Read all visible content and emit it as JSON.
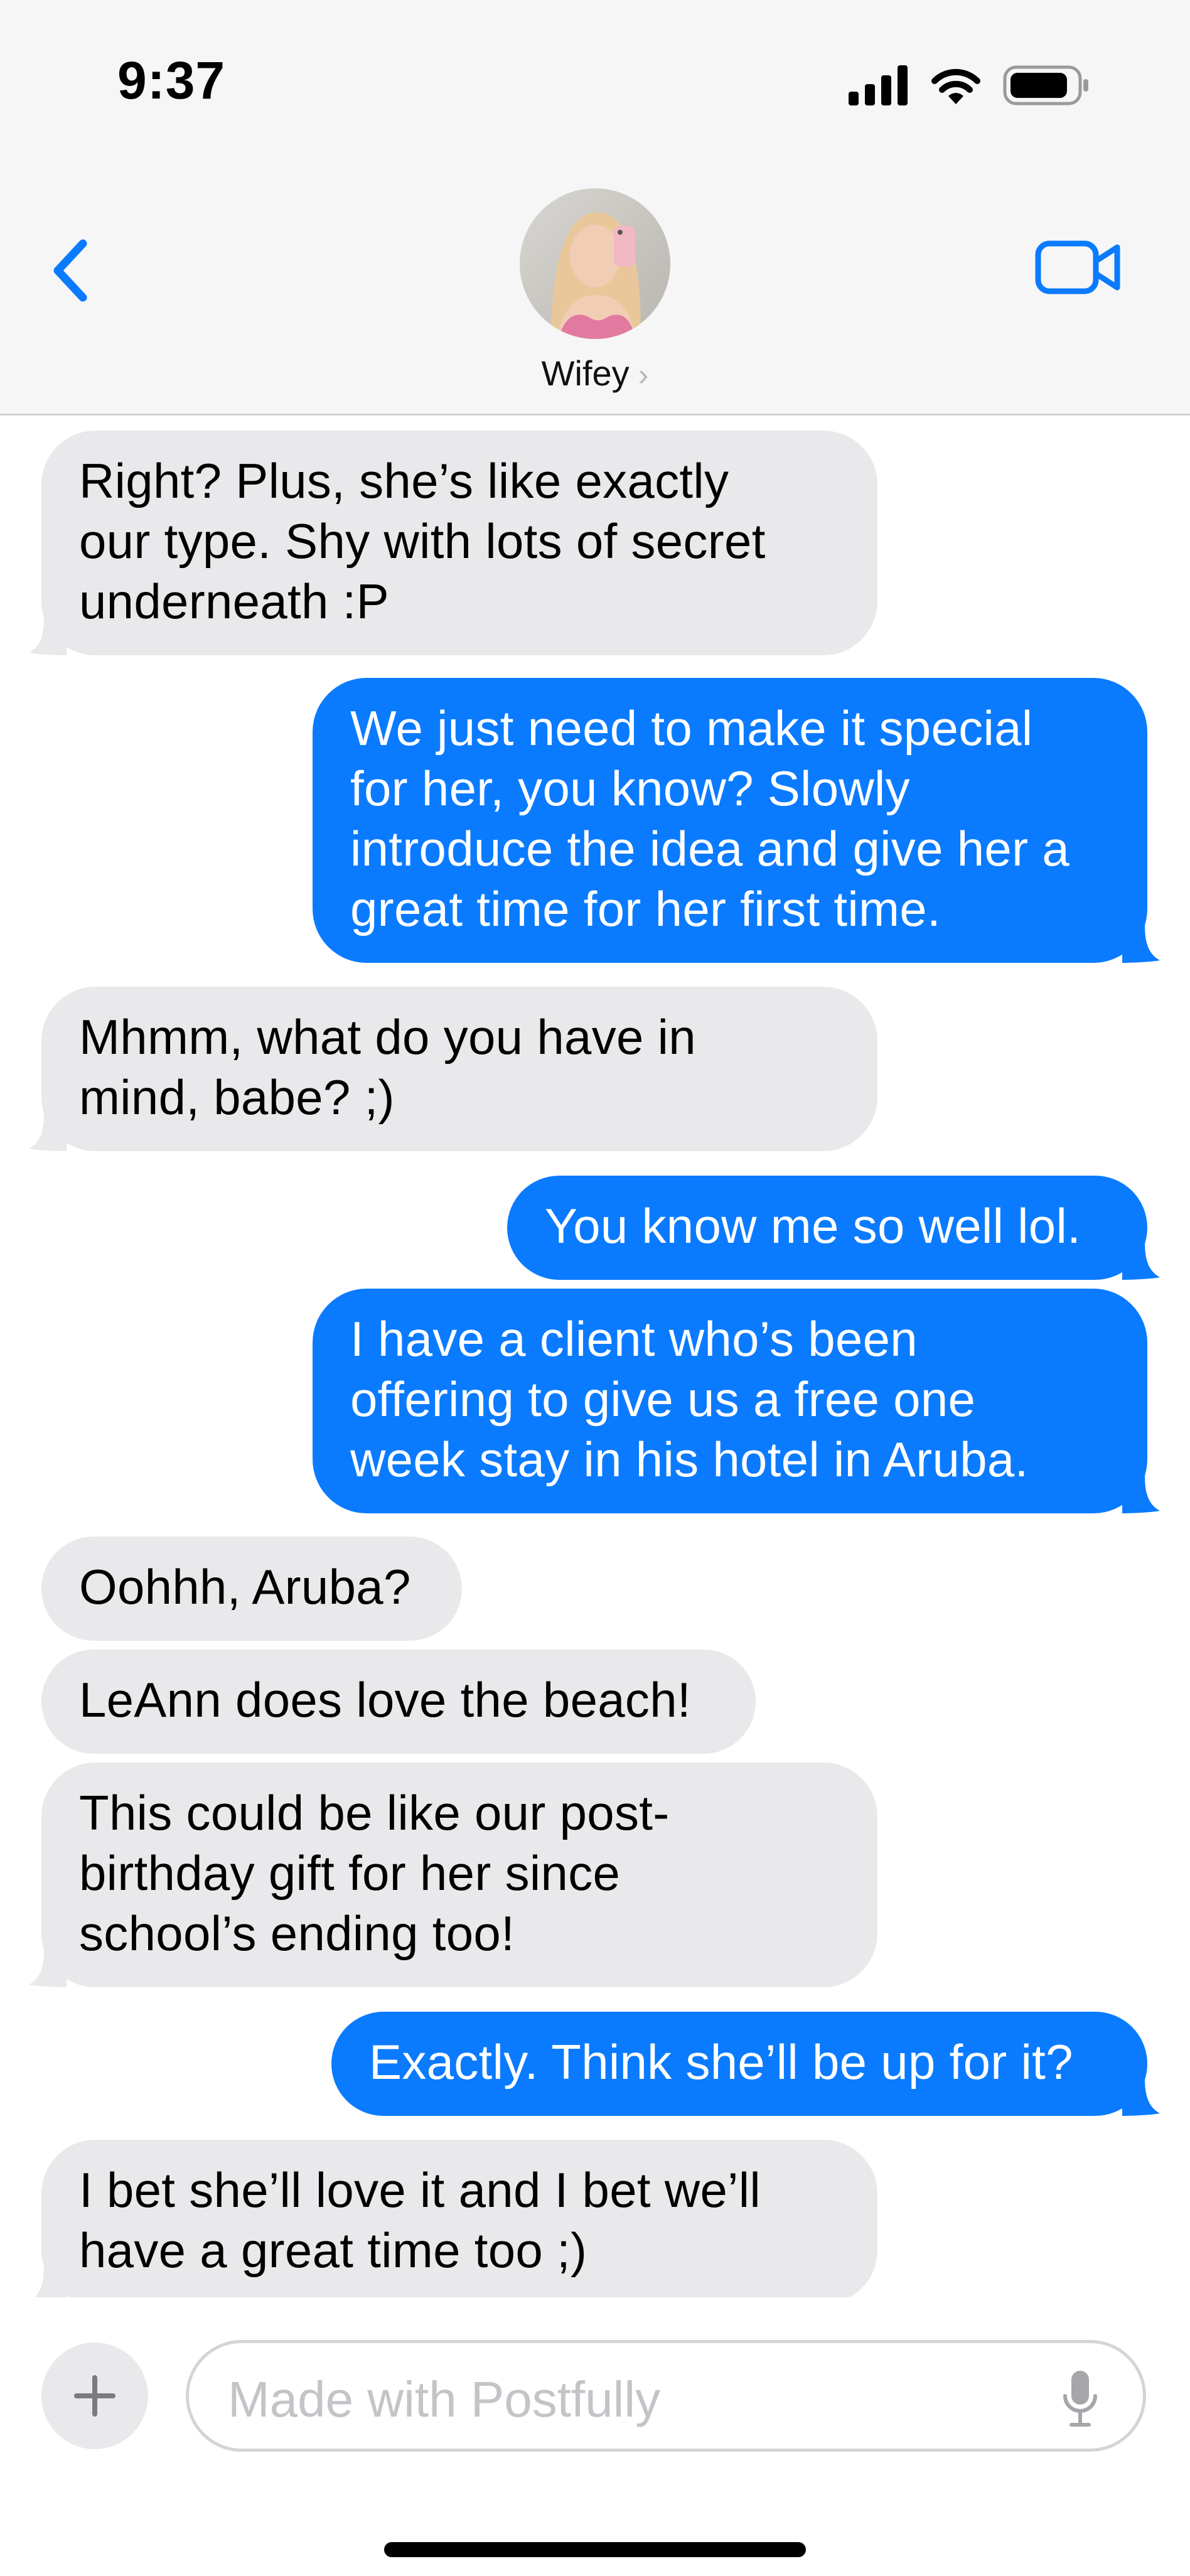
{
  "status_bar": {
    "time": "9:37"
  },
  "header": {
    "contact_name": "Wifey",
    "name_chevron": "›"
  },
  "messages": [
    {
      "from": "them",
      "lines": [
        "Right? Plus, she’s like exactly",
        "our type. Shy with lots of secret",
        "underneath :P"
      ]
    },
    {
      "from": "me",
      "lines": [
        "We just need to make it special",
        "for her, you know? Slowly",
        "introduce the idea and give her a",
        "great time for her first time."
      ]
    },
    {
      "from": "them",
      "lines": [
        "Mhmm, what do you have in",
        "mind, babe? ;)"
      ]
    },
    {
      "from": "me",
      "lines": [
        "You know me so well lol."
      ]
    },
    {
      "from": "me",
      "lines": [
        "I have a client who’s been",
        "offering to give us a free one",
        "week stay in his hotel in Aruba."
      ]
    },
    {
      "from": "them",
      "lines": [
        "Oohhh, Aruba?"
      ]
    },
    {
      "from": "them",
      "lines": [
        "LeAnn does love the beach!"
      ]
    },
    {
      "from": "them",
      "lines": [
        "This could be like our post-",
        "birthday gift for her since",
        "school’s ending too!"
      ]
    },
    {
      "from": "me",
      "lines": [
        "Exactly. Think she’ll be up for it?"
      ]
    },
    {
      "from": "them",
      "lines": [
        "I bet she’ll love it and I bet we’ll",
        "have a great time too ;)"
      ]
    }
  ],
  "composer": {
    "placeholder": "Made with Postfully",
    "plus_label": "+"
  },
  "colors": {
    "outgoing": "#0a7bff",
    "incoming": "#e9e9eb",
    "accent": "#0a7bff"
  },
  "icons": [
    "signal-icon",
    "wifi-icon",
    "battery-icon",
    "back-chevron-icon",
    "video-call-icon",
    "plus-icon",
    "microphone-icon"
  ]
}
